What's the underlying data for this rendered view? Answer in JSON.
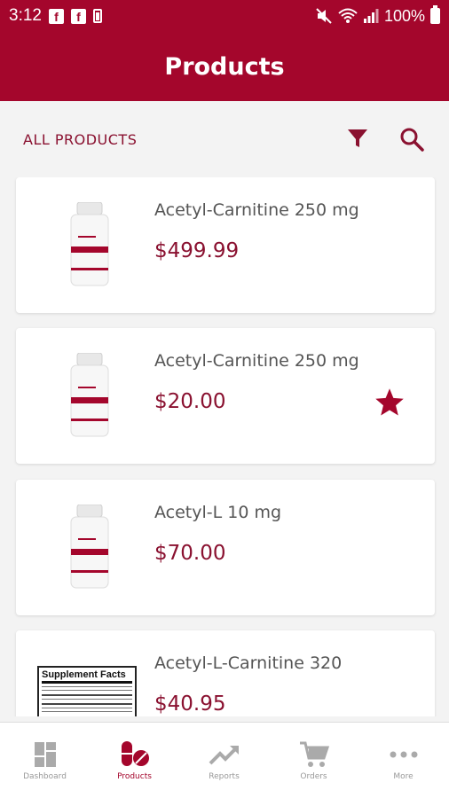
{
  "status_bar": {
    "time": "3:12",
    "battery_pct": "100%",
    "notification_icons": [
      "facebook-icon",
      "facebook-icon",
      "battery-saver-icon"
    ],
    "system_icons": [
      "mute-icon",
      "wifi-icon",
      "signal-icon",
      "battery-icon"
    ]
  },
  "app_bar": {
    "title": "Products"
  },
  "filter_bar": {
    "label": "ALL PRODUCTS",
    "icons": [
      "filter-icon",
      "search-icon"
    ]
  },
  "products": [
    {
      "name": "Acetyl-Carnitine 250 mg",
      "price": "$499.99",
      "favorite": false,
      "image": "bottle"
    },
    {
      "name": "Acetyl-Carnitine 250 mg",
      "price": "$20.00",
      "favorite": true,
      "image": "bottle"
    },
    {
      "name": "Acetyl-L 10 mg",
      "price": "$70.00",
      "favorite": false,
      "image": "bottle"
    },
    {
      "name": "Acetyl-L-Carnitine 320",
      "price": "$40.95",
      "favorite": false,
      "image": "supplement-facts",
      "image_title": "Supplement Facts"
    }
  ],
  "bottom_nav": [
    {
      "label": "Dashboard",
      "icon": "dashboard-icon",
      "active": false
    },
    {
      "label": "Products",
      "icon": "pills-icon",
      "active": true
    },
    {
      "label": "Reports",
      "icon": "trending-icon",
      "active": false
    },
    {
      "label": "Orders",
      "icon": "cart-icon",
      "active": false
    },
    {
      "label": "More",
      "icon": "more-icon",
      "active": false
    }
  ],
  "colors": {
    "brand": "#a4062c",
    "price": "#8a1130",
    "inactive": "#999999",
    "background": "#f3f3f3"
  }
}
